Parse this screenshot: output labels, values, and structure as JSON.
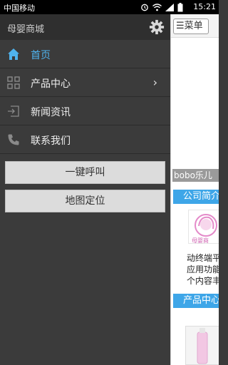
{
  "status_bar": {
    "carrier": "中国移动",
    "time": "15:21"
  },
  "drawer": {
    "title": "母婴商城",
    "items": [
      {
        "label": "首页",
        "icon": "home-icon",
        "active": true
      },
      {
        "label": "产品中心",
        "icon": "grid-icon",
        "has_submenu": true
      },
      {
        "label": "新闻资讯",
        "icon": "news-icon"
      },
      {
        "label": "联系我们",
        "icon": "phone-icon"
      }
    ],
    "buttons": [
      "一键呼叫",
      "地图定位"
    ],
    "chevron": "›"
  },
  "main": {
    "menu_label": "☰菜单",
    "banner_text": "bobo乐儿",
    "section_company": "公司简介",
    "company_text": [
      "动终端平",
      "应用功能",
      "个内容丰"
    ],
    "section_products": "产品中心",
    "logo_text": "母婴商"
  },
  "colors": {
    "accent": "#3ea6e8",
    "drawer_bg": "#3b3b3b",
    "active_text": "#4fb3ee"
  }
}
